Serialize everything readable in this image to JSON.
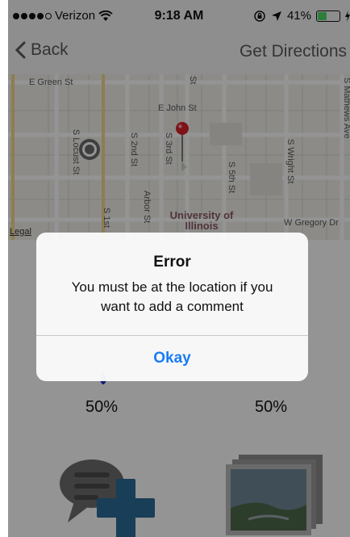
{
  "status_bar": {
    "carrier": "Verizon",
    "time": "9:18 AM",
    "battery": "41%",
    "battery_level": 0.41,
    "icons": [
      "signal-dots-icon",
      "wifi-icon",
      "orientation-lock-icon",
      "location-arrow-icon",
      "battery-icon",
      "charging-icon"
    ]
  },
  "nav": {
    "back_label": "Back",
    "back_icon": "chevron-left-icon",
    "directions_label": "Get Directions"
  },
  "map": {
    "streets": {
      "green": "E Green St",
      "john": "E John St",
      "locust": "S Locust St",
      "second": "S 2nd St",
      "third": "S 3rd St",
      "fifth": "S 5th St",
      "wright": "S Wright St",
      "mathews": "S Mathews Ave",
      "arbor": "Arbor St",
      "first": "S 1st",
      "gregory": "W Gregory Dr",
      "st_fragment": "St"
    },
    "campus": "University of Illinois",
    "legal": "Legal",
    "icons": [
      "user-location-icon",
      "map-pin-icon"
    ]
  },
  "content": {
    "left_percent": "50%",
    "right_percent": "50%",
    "icons": [
      "add-comment-icon",
      "photo-gallery-icon"
    ]
  },
  "alert": {
    "title": "Error",
    "message": "You must be at the location if you want to add a comment",
    "button": "Okay"
  },
  "colors": {
    "accent": "#1a7cf5",
    "pin": "#d9222a",
    "battery": "#4cd964",
    "nav_text": "#5a5a5a",
    "campus": "#8a5a6a"
  }
}
